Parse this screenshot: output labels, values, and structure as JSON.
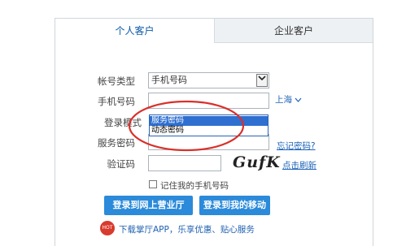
{
  "tabs": {
    "personal": "个人客户",
    "enterprise": "企业客户"
  },
  "form": {
    "account_type_label": "帐号类型",
    "account_type_value": "手机号码",
    "phone_label": "手机号码",
    "phone_value": "",
    "city": "上海",
    "login_mode_label": "登录模式",
    "login_mode_partial": "登录模式",
    "password_label": "服务密码",
    "password_value": "",
    "forgot_password": "忘记密码?",
    "captcha_label": "验证码",
    "captcha_value": "",
    "captcha_image_text": "GufK",
    "refresh_captcha": "点击刷新",
    "remember_label": "记住我的手机号码"
  },
  "dropdown": {
    "options": [
      "服务密码",
      "动态密码"
    ],
    "selected_index": 0
  },
  "buttons": {
    "login_hall": "登录到网上营业厅",
    "login_mobile": "登录到我的移动"
  },
  "promo": {
    "badge": "HOT",
    "text": "下载掌厅APP，乐享优惠、贴心服务"
  },
  "colors": {
    "accent_blue": "#2b8ad9",
    "link_blue": "#1b63b8",
    "annotation_red": "#d9302a",
    "selection_blue": "#2e6fd0"
  }
}
